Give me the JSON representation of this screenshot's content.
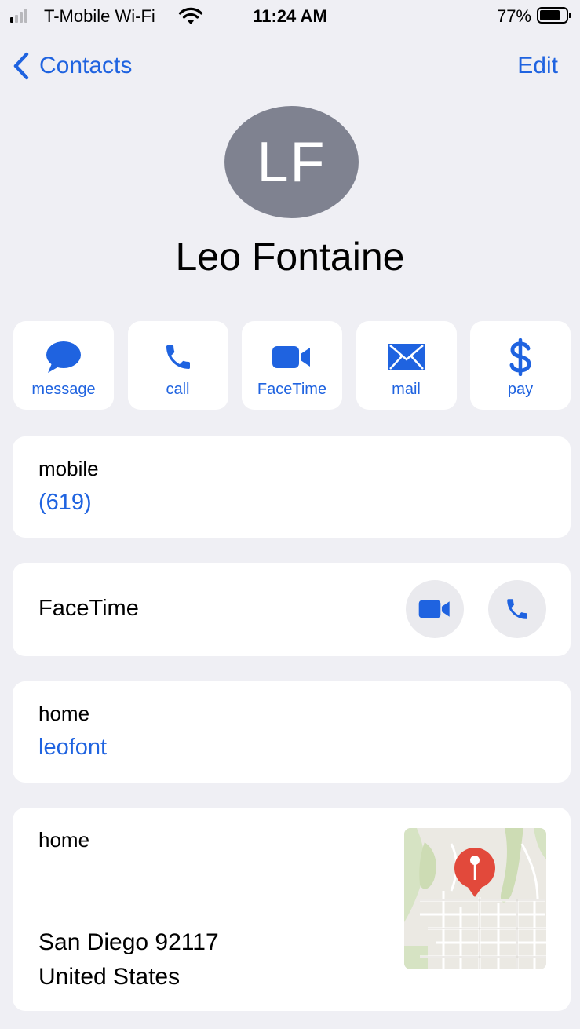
{
  "status_bar": {
    "carrier": "T-Mobile Wi-Fi",
    "time": "11:24 AM",
    "battery_percent": "77%",
    "battery_level": 0.77,
    "signal_bars_active": 1,
    "signal_bars_total": 4
  },
  "nav": {
    "back_label": "Contacts",
    "edit_label": "Edit"
  },
  "contact": {
    "initials": "LF",
    "name": "Leo Fontaine"
  },
  "actions": [
    {
      "label": "message",
      "icon": "message-bubble-icon"
    },
    {
      "label": "call",
      "icon": "phone-icon"
    },
    {
      "label": "FaceTime",
      "icon": "video-camera-icon"
    },
    {
      "label": "mail",
      "icon": "envelope-icon"
    },
    {
      "label": "pay",
      "icon": "dollar-icon"
    }
  ],
  "phone": {
    "label": "mobile",
    "value": "(619)"
  },
  "facetime": {
    "label": "FaceTime"
  },
  "email": {
    "label": "home",
    "value": "leofont"
  },
  "address": {
    "label": "home",
    "city_line": "San Diego 92117",
    "country": "United States"
  },
  "colors": {
    "accent": "#1f63e0",
    "background": "#efeff4",
    "avatar": "#7f8290",
    "map_pin": "#e2493b"
  }
}
